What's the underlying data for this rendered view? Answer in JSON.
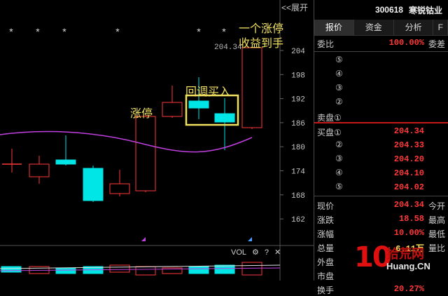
{
  "chart": {
    "expand_label": "<<展开",
    "star_marker": "*",
    "y_axis_ticks": [
      "204",
      "198",
      "192",
      "186",
      "180",
      "174",
      "168",
      "162"
    ],
    "high_price_label": "204.34",
    "annotations": {
      "limit_up": "涨停",
      "pullback_buy": "回调买入",
      "profit_line1": "一个涨停",
      "profit_line2": "收益到手"
    },
    "volume_toolbar": {
      "label": "VOL",
      "settings_icon": "⚙",
      "help_icon": "?",
      "close_icon": "✕"
    },
    "colors": {
      "up": "#ff3838",
      "down": "#00e5e5",
      "ma": "#c040e0",
      "highlight": "#f0e060"
    }
  },
  "quote_panel": {
    "code": "300618",
    "name": "寒锐钴业",
    "tabs": [
      "报价",
      "资金",
      "分析",
      "F"
    ],
    "ratio": {
      "label": "委比",
      "value": "100.00%",
      "label2": "委差"
    },
    "ask_levels": [
      "⑤",
      "④",
      "③",
      "②"
    ],
    "ask1_label": "卖盘①",
    "bids": [
      {
        "label": "买盘①",
        "price": "204.34"
      },
      {
        "label": "②",
        "price": "204.33"
      },
      {
        "label": "③",
        "price": "204.20"
      },
      {
        "label": "④",
        "price": "204.10"
      },
      {
        "label": "⑤",
        "price": "204.02"
      }
    ],
    "stats": [
      {
        "label": "现价",
        "value": "204.34",
        "label2": "今开"
      },
      {
        "label": "涨跌",
        "value": "18.58",
        "label2": "最高"
      },
      {
        "label": "涨幅",
        "value": "10.00%",
        "label2": "最低"
      },
      {
        "label": "总量",
        "value": "6.11万",
        "label2": "量比"
      },
      {
        "label": "外盘",
        "value": "",
        "label2": ""
      },
      {
        "label": "市盘",
        "value": "",
        "label2": ""
      },
      {
        "label": "换手",
        "value": "20.27%",
        "label2": ""
      }
    ]
  },
  "watermark": {
    "number": "10",
    "cn": "拾荒网",
    "en": "Huang.CN"
  }
}
